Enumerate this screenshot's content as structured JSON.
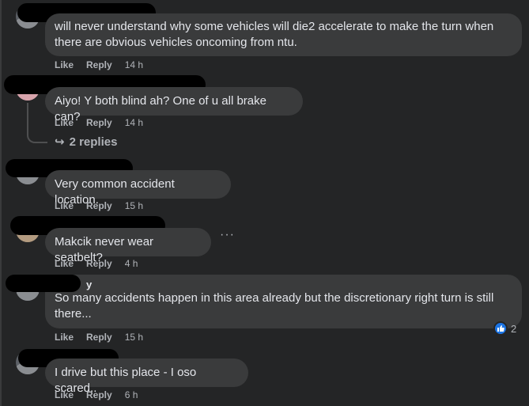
{
  "comments": [
    {
      "text": "will never understand why some vehicles will die2 accelerate to make the turn when there are obvious vehicles oncoming from ntu.",
      "like": "Like",
      "reply": "Reply",
      "time": "14 h"
    },
    {
      "text": "Aiyo! Y both blind ah? One of u all brake can?",
      "like": "Like",
      "reply": "Reply",
      "time": "14 h",
      "replies_label": "2 replies"
    },
    {
      "text": "Very common accident location.",
      "like": "Like",
      "reply": "Reply",
      "time": "15 h"
    },
    {
      "text": "Makcik never wear seatbelt?",
      "like": "Like",
      "reply": "Reply",
      "time": "4 h",
      "more": "···"
    },
    {
      "name_tail": "y",
      "text": "So many accidents happen in this area already but the discretionary right turn is still there...",
      "like": "Like",
      "reply": "Reply",
      "time": "15 h",
      "reaction_count": "2"
    },
    {
      "text": "I drive but this place - I oso scared..",
      "like": "Like",
      "reply": "Reply",
      "time": "6 h"
    }
  ],
  "colors": {
    "background": "#242526",
    "bubble": "#3a3b3c",
    "text": "#e4e6eb",
    "secondary": "#b0b3b8",
    "like_blue": "#1b74e4"
  },
  "icons": {
    "reply_arrow": "reply-arrow-icon",
    "like_reaction": "thumbs-up-icon"
  }
}
